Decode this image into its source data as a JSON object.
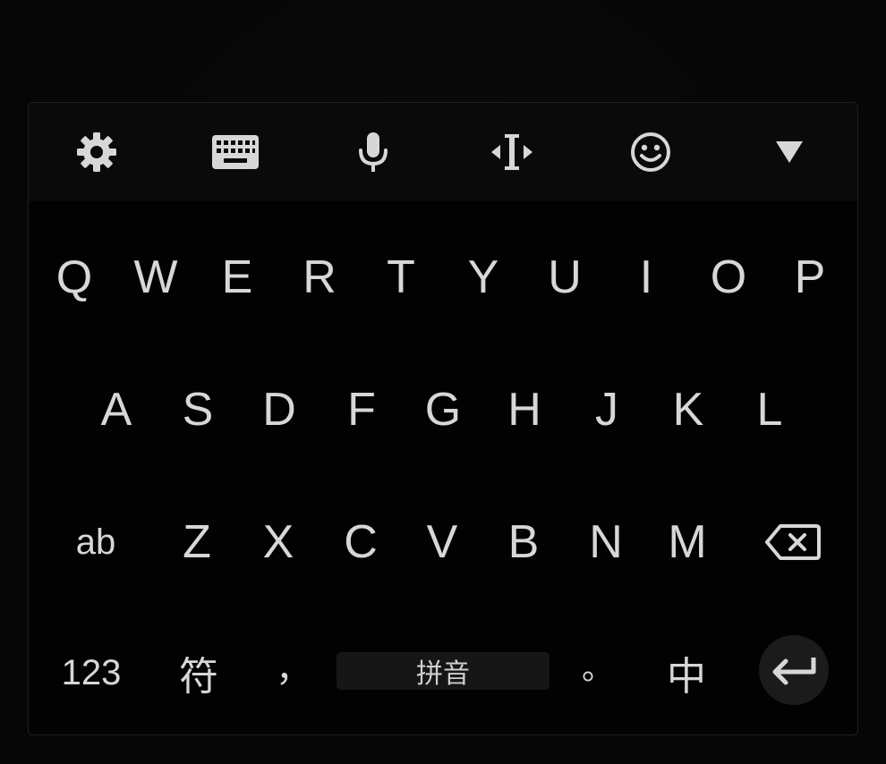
{
  "toolbar": {
    "icons": [
      "gear-icon",
      "keyboard-icon",
      "microphone-icon",
      "text-cursor-icon",
      "emoji-icon",
      "triangle-down-icon"
    ]
  },
  "rows": {
    "row1": [
      "Q",
      "W",
      "E",
      "R",
      "T",
      "Y",
      "U",
      "I",
      "O",
      "P"
    ],
    "row2": [
      "A",
      "S",
      "D",
      "F",
      "G",
      "H",
      "J",
      "K",
      "L"
    ],
    "row3": {
      "shift": "ab",
      "letters": [
        "Z",
        "X",
        "C",
        "V",
        "B",
        "N",
        "M"
      ]
    },
    "row4": {
      "numbers": "123",
      "symbols": "符",
      "comma": "，",
      "space": "拼音",
      "period": "。",
      "lang": "中"
    }
  },
  "colors": {
    "background": "#060606",
    "keyboard_bg": "#020202",
    "toolbar_bg": "#0a0a0a",
    "key_text": "#d7d7d7",
    "space_bg": "#161616",
    "enter_bg": "#1b1b1b"
  }
}
